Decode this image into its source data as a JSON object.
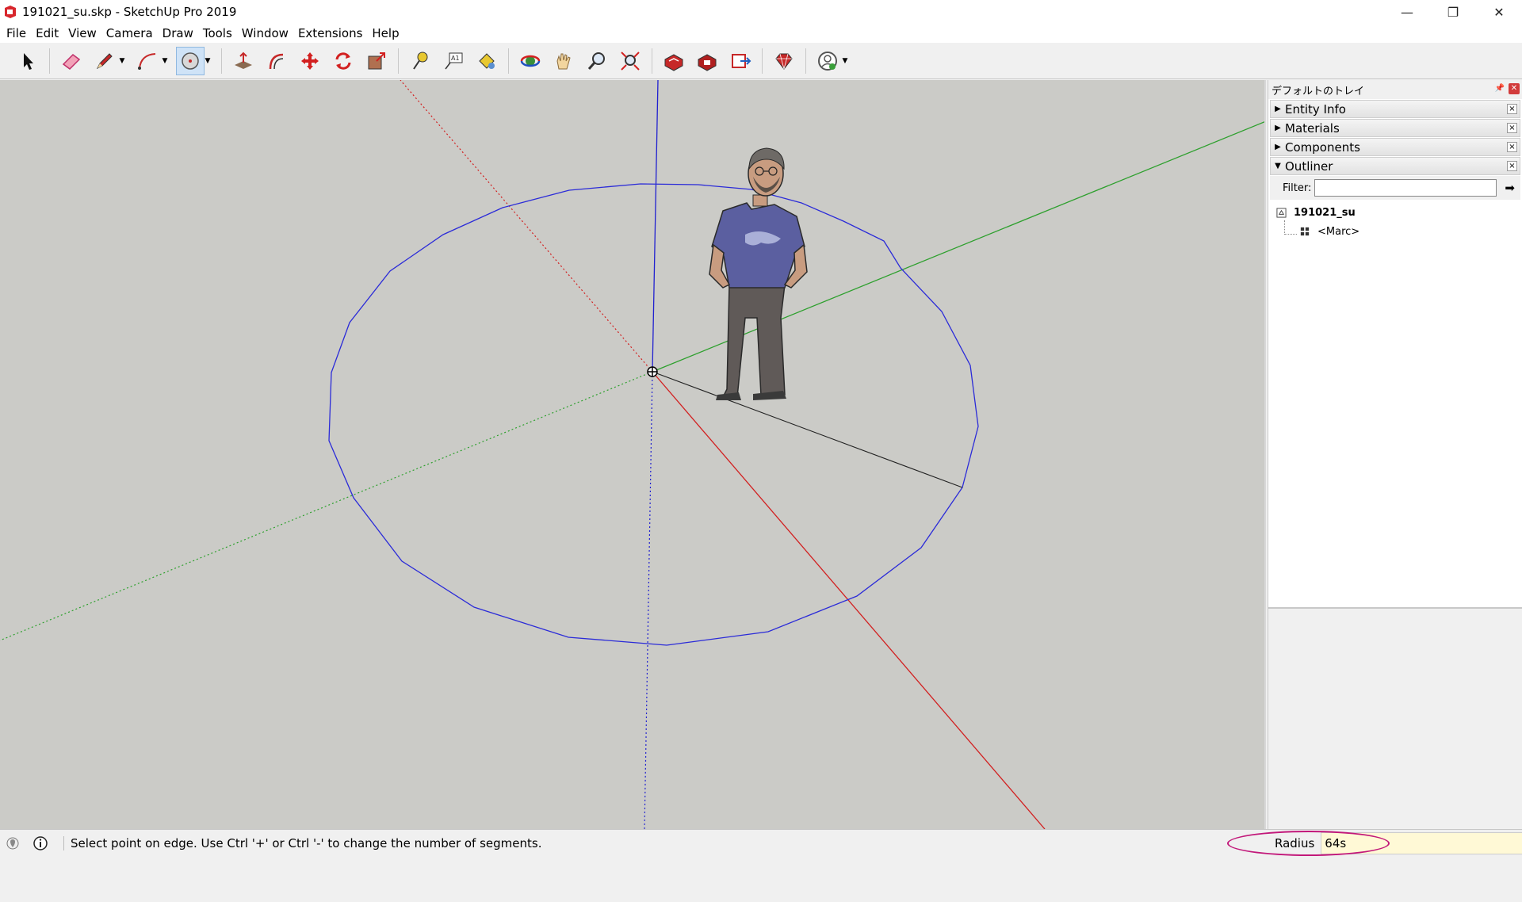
{
  "window": {
    "title": "191021_su.skp - SketchUp Pro 2019",
    "controls": {
      "minimize": "—",
      "restore": "❐",
      "close": "✕"
    }
  },
  "menu": [
    "File",
    "Edit",
    "View",
    "Camera",
    "Draw",
    "Tools",
    "Window",
    "Extensions",
    "Help"
  ],
  "toolbar": {
    "tools": [
      {
        "name": "select",
        "icon": "arrow-cursor-icon"
      },
      {
        "name": "eraser",
        "icon": "eraser-icon"
      },
      {
        "name": "line",
        "icon": "pencil-icon"
      },
      {
        "name": "arc",
        "icon": "arc-icon"
      },
      {
        "name": "circle",
        "icon": "circle-icon",
        "active": true
      },
      {
        "name": "push-pull",
        "icon": "push-pull-icon"
      },
      {
        "name": "offset",
        "icon": "offset-icon"
      },
      {
        "name": "move",
        "icon": "move-icon"
      },
      {
        "name": "rotate",
        "icon": "rotate-icon"
      },
      {
        "name": "scale",
        "icon": "scale-icon"
      },
      {
        "name": "tape-measure",
        "icon": "tape-measure-icon"
      },
      {
        "name": "text",
        "icon": "text-icon"
      },
      {
        "name": "paint-bucket",
        "icon": "paint-bucket-icon"
      },
      {
        "name": "orbit",
        "icon": "orbit-icon"
      },
      {
        "name": "pan",
        "icon": "pan-hand-icon"
      },
      {
        "name": "zoom",
        "icon": "zoom-icon"
      },
      {
        "name": "zoom-extents",
        "icon": "zoom-extents-icon"
      },
      {
        "name": "3d-warehouse",
        "icon": "warehouse-icon"
      },
      {
        "name": "extension-warehouse",
        "icon": "extension-warehouse-icon"
      },
      {
        "name": "send-to-layout",
        "icon": "layout-icon"
      },
      {
        "name": "extension-manager",
        "icon": "ruby-gem-icon"
      },
      {
        "name": "account",
        "icon": "user-account-icon"
      }
    ]
  },
  "tray": {
    "title": "デフォルトのトレイ",
    "panels": [
      {
        "label": "Entity Info",
        "expanded": false
      },
      {
        "label": "Materials",
        "expanded": false
      },
      {
        "label": "Components",
        "expanded": false
      },
      {
        "label": "Outliner",
        "expanded": true
      }
    ],
    "filter_label": "Filter:",
    "filter_value": "",
    "tree": {
      "root": "191021_su",
      "children": [
        "<Marc>"
      ]
    }
  },
  "status": {
    "message": "Select point on edge. Use Ctrl '+' or Ctrl '-' to change the number of segments.",
    "measure_label": "Radius",
    "measure_value": "64s"
  },
  "colors": {
    "viewport_bg": "#cbcbc7",
    "axis_red": "#d22020",
    "axis_green": "#2ea02e",
    "axis_blue": "#2020d0",
    "circle": "#2b2bd8",
    "highlight_oval": "#c2187a"
  }
}
